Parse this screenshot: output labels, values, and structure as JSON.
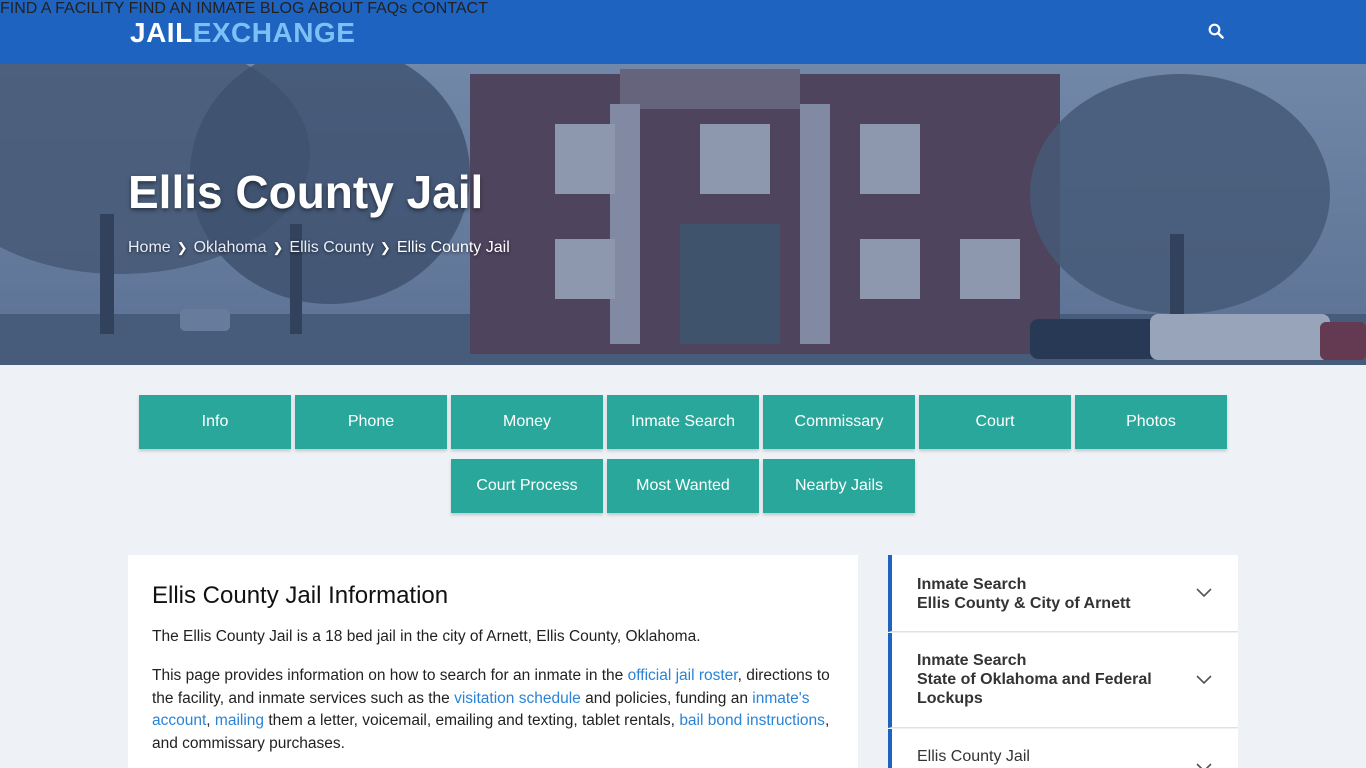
{
  "header": {
    "logo_part1": "JAIL",
    "logo_part2": "EXCHANGE",
    "nav": [
      "FIND A FACILITY",
      "FIND AN INMATE",
      "BLOG",
      "ABOUT",
      "FAQs",
      "CONTACT"
    ]
  },
  "hero": {
    "title": "Ellis County Jail",
    "breadcrumb": [
      "Home",
      "Oklahoma",
      "Ellis County",
      "Ellis County Jail"
    ]
  },
  "tabs": {
    "row1": [
      "Info",
      "Phone",
      "Money",
      "Inmate Search",
      "Commissary",
      "Court",
      "Photos"
    ],
    "row2": [
      "Court Process",
      "Most Wanted",
      "Nearby Jails"
    ]
  },
  "main": {
    "heading": "Ellis County Jail Information",
    "p1": "The Ellis County Jail is a 18 bed jail in the city of Arnett, Ellis County, Oklahoma.",
    "p2_a": "This page provides information on how to search for an inmate in the ",
    "p2_link1": "official jail roster",
    "p2_b": ", directions to the facility, and inmate services such as the ",
    "p2_link2": "visitation schedule",
    "p2_c": " and policies, funding an ",
    "p2_link3": "inmate's account",
    "p2_d": ", ",
    "p2_link4": "mailing",
    "p2_e": " them a letter, voicemail, emailing and texting, tablet rentals, ",
    "p2_link5": "bail bond instructions",
    "p2_f": ", and commissary purchases."
  },
  "sidebar": {
    "items": [
      {
        "line1": "Inmate Search",
        "line2": "Ellis County & City of Arnett"
      },
      {
        "line1": "Inmate Search",
        "line2": "State of Oklahoma and Federal",
        "line3": "Lockups"
      },
      {
        "line1": "Ellis County Jail"
      }
    ]
  },
  "colors": {
    "header_bg": "#1e63c0",
    "tab_bg": "#2aa79b",
    "link": "#2a83d6",
    "page_bg": "#eef1f5"
  },
  "icons": [
    "search-icon",
    "chevron-right-icon",
    "chevron-down-icon"
  ]
}
